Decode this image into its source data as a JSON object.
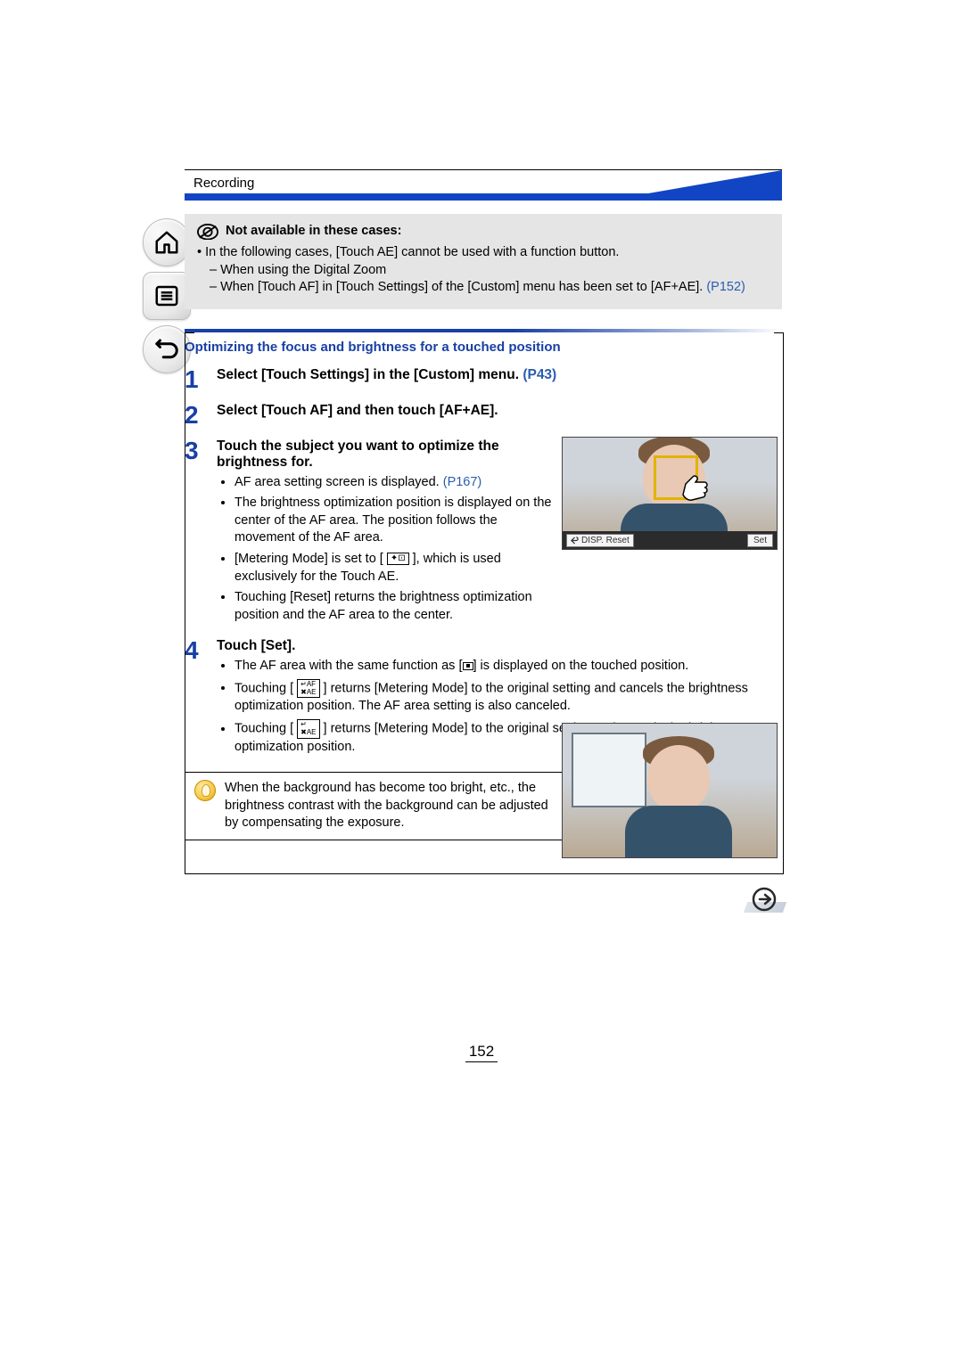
{
  "header": {
    "section_label": "Recording"
  },
  "nav": {
    "home_label": "home-icon",
    "toc_label": "toc-icon",
    "back_label": "back-icon"
  },
  "not_available": {
    "title": "Not available in these cases:",
    "intro_bullet": "In the following cases, [Touch AE] cannot be used with a function button.",
    "dash1": "– When using the Digital Zoom",
    "dash2_a": "– When [Touch AF] in [Touch Settings] of the [Custom] menu has been set to [AF+AE]. ",
    "dash2_link": "(P152)"
  },
  "section_heading": "Optimizing the focus and brightness for a touched position",
  "steps": {
    "s1": {
      "num": "1",
      "head_a": "Select [Touch Settings] in the [Custom] menu. ",
      "head_link": "(P43)"
    },
    "s2": {
      "num": "2",
      "head": "Select [Touch AF] and then touch [AF+AE]."
    },
    "s3": {
      "num": "3",
      "head": "Touch the subject you want to optimize the brightness for.",
      "b1_a": "AF area setting screen is displayed. ",
      "b1_link": "(P167)",
      "b2": "The brightness optimization position is displayed on the center of the AF area. The position follows the movement of the AF area.",
      "b3_a": "[Metering Mode] is set to [ ",
      "b3_icon": "touch-ae-mode-icon",
      "b3_b": " ], which is used exclusively for the Touch AE.",
      "b4": "Touching [Reset] returns the brightness optimization position and the AF area to the center."
    },
    "s4": {
      "num": "4",
      "head": "Touch [Set].",
      "b1_a": "The AF area with the same function as [",
      "b1_icon": "af-area-icon",
      "b1_b": "] is displayed on the touched position.",
      "b2_a": "Touching [ ",
      "b2_icon": "cancel-afae-icon",
      "b2_b": " ] returns [Metering Mode] to the original setting and cancels the brightness optimization position. The AF area setting is also canceled.",
      "b3_a": "Touching [ ",
      "b3_icon": "cancel-ae-icon",
      "b3_b": " ] returns [Metering Mode] to the original setting and cancels the brightness optimization position."
    }
  },
  "tip": {
    "text": "When the background has become too bright, etc., the brightness contrast with the background can be adjusted by compensating the exposure."
  },
  "thumb1_bar": {
    "left_icon": "back-small-icon",
    "left_label": "DISP. Reset",
    "right_label": "Set"
  },
  "page_number": "152",
  "next_arrow": "next-page-icon"
}
